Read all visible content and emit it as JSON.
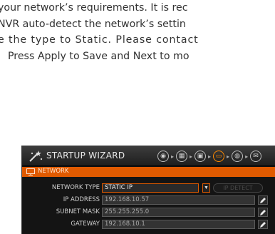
{
  "intro": {
    "lines": [
      "your network’s requirements. It is rec",
      "NVR auto-detect the network’s settin",
      "e the type to Static. Please contact",
      "Press Apply to Save and Next to mo"
    ]
  },
  "wizard": {
    "title": "STARTUP WIZARD",
    "steps": [
      {
        "icon": "disc-icon",
        "glyph": "◉",
        "active": false
      },
      {
        "icon": "calendar-icon",
        "glyph": "▦",
        "active": false
      },
      {
        "icon": "harddrive-icon",
        "glyph": "▣",
        "active": false
      },
      {
        "icon": "network-icon",
        "glyph": "▭",
        "active": true
      },
      {
        "icon": "camera-icon",
        "glyph": "◍",
        "active": false
      },
      {
        "icon": "mail-icon",
        "glyph": "✉",
        "active": false
      }
    ],
    "step_arrow": "▸",
    "tab": {
      "label": "NETWORK"
    },
    "fields": {
      "network_type": {
        "label": "NETWORK TYPE",
        "value": "STATIC IP",
        "dropdown_glyph": "▼"
      },
      "ip_detect": {
        "label": "IP DETECT"
      },
      "ip_address": {
        "label": "IP ADDRESS",
        "value": "192.168.10.57"
      },
      "subnet_mask": {
        "label": "SUBNET MASK",
        "value": "255.255.255.0"
      },
      "gateway": {
        "label": "GATEWAY",
        "value": "192.168.10.1"
      }
    }
  },
  "colors": {
    "accent": "#e05a00",
    "active_step": "#ff8a00",
    "window_bg": "#141414"
  }
}
